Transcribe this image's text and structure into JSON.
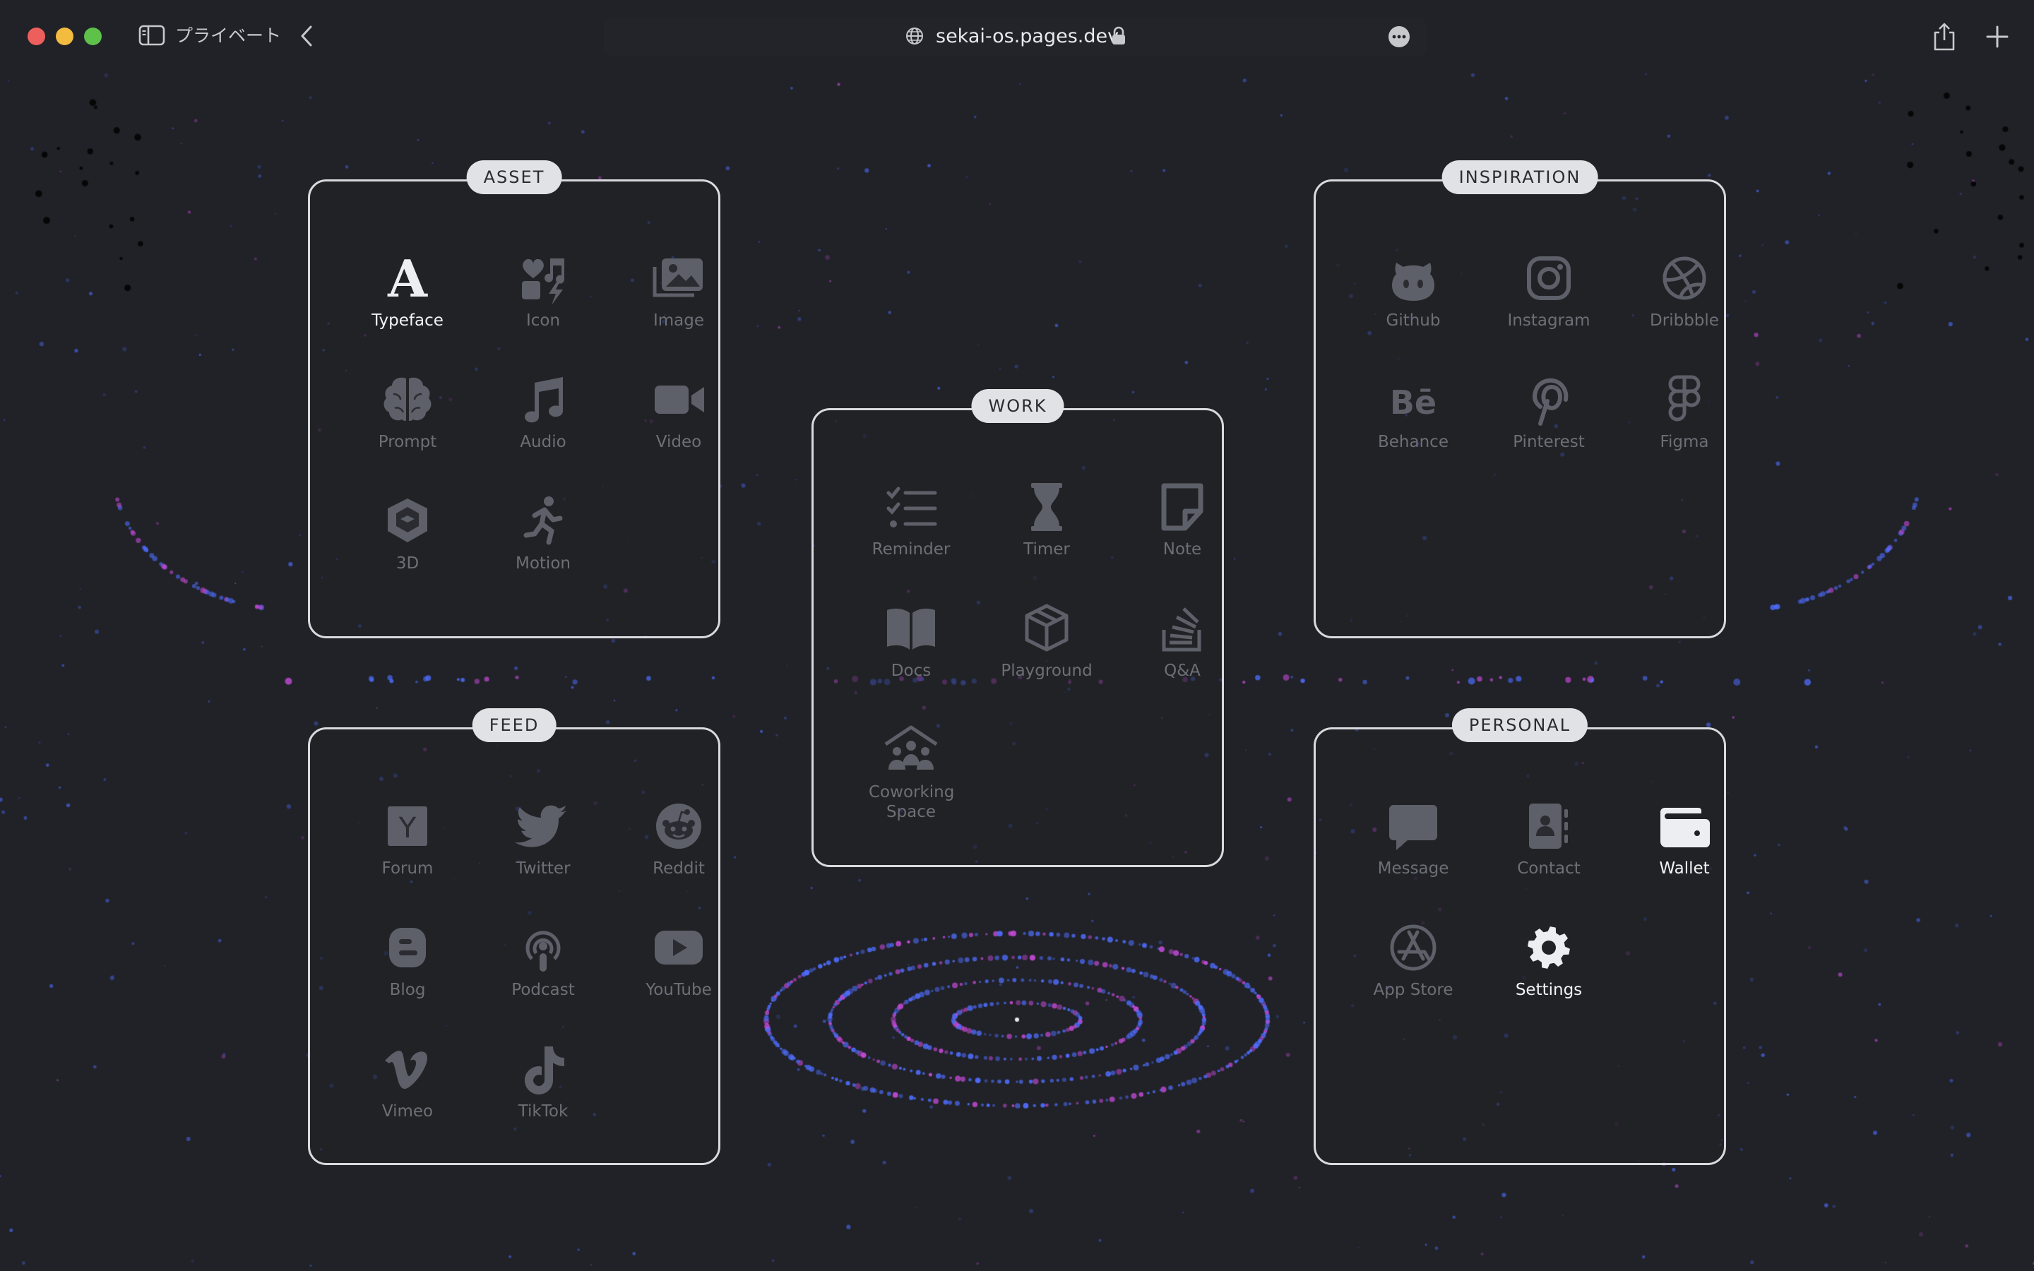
{
  "toolbar": {
    "private_label": "プライベート",
    "url": "sekai-os.pages.dev"
  },
  "panels": {
    "asset": {
      "label": "ASSET",
      "apps": [
        "Typeface",
        "Icon",
        "Image",
        "Prompt",
        "Audio",
        "Video",
        "3D",
        "Motion"
      ]
    },
    "work": {
      "label": "WORK",
      "apps": [
        "Reminder",
        "Timer",
        "Note",
        "Docs",
        "Playground",
        "Q&A",
        "Coworking Space"
      ]
    },
    "inspiration": {
      "label": "INSPIRATION",
      "apps": [
        "Github",
        "Instagram",
        "Dribbble",
        "Behance",
        "Pinterest",
        "Figma"
      ]
    },
    "feed": {
      "label": "FEED",
      "apps": [
        "Forum",
        "Twitter",
        "Reddit",
        "Blog",
        "Podcast",
        "YouTube",
        "Vimeo",
        "TikTok"
      ]
    },
    "personal": {
      "label": "PERSONAL",
      "apps": [
        "Message",
        "Contact",
        "Wallet",
        "App Store",
        "Settings"
      ]
    }
  },
  "icon_text": {
    "typeface_glyph": "A",
    "forum_glyph": "Y",
    "behance_glyph": "Bē"
  },
  "colors": {
    "background": "#202227",
    "panel_border": "#d9dadd",
    "label_pill": "#e1e2e5",
    "dim_icon": "#5d6068",
    "active_icon": "#eceef1",
    "star_blue": "#4f6dff",
    "star_magenta": "#c54ad8"
  },
  "icons": {
    "asset": [
      "typeface-icon",
      "icon-icon",
      "image-icon",
      "prompt-brain-icon",
      "audio-note-icon",
      "video-camera-icon",
      "3d-cube-icon",
      "motion-runner-icon"
    ],
    "work": [
      "reminder-list-icon",
      "timer-hourglass-icon",
      "note-icon",
      "docs-book-icon",
      "playground-box-icon",
      "qa-stack-icon",
      "coworking-people-icon"
    ],
    "inspiration": [
      "github-icon",
      "instagram-icon",
      "dribbble-icon",
      "behance-icon",
      "pinterest-icon",
      "figma-icon"
    ],
    "feed": [
      "forum-y-icon",
      "twitter-icon",
      "reddit-icon",
      "blog-icon",
      "podcast-icon",
      "youtube-icon",
      "vimeo-icon",
      "tiktok-icon"
    ],
    "personal": [
      "message-icon",
      "contact-icon",
      "wallet-icon",
      "app-store-icon",
      "settings-gear-icon"
    ]
  }
}
